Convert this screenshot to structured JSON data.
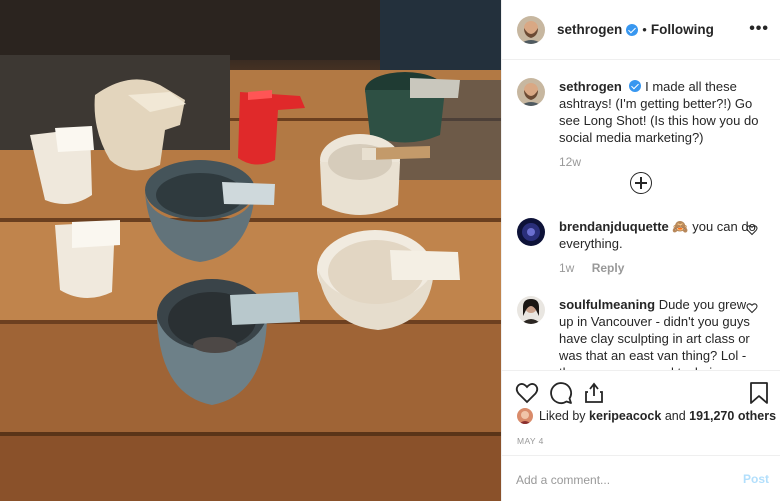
{
  "post": {
    "username": "sethrogen",
    "follow_status": "Following",
    "separator": "•",
    "more_icon": "more-options-icon",
    "more_glyph": "•••"
  },
  "caption": {
    "username": "sethrogen",
    "text": "I made all these ashtrays! (I'm getting better?!) Go see Long Shot! (Is this how you do social media marketing?)",
    "age": "12w"
  },
  "comments": [
    {
      "username": "brendanjduquette",
      "emoji": "🙈",
      "text": "you can do everything.",
      "age": "1w",
      "reply_label": "Reply"
    },
    {
      "username": "soulfulmeaning",
      "text": "Dude you grew up in Vancouver - didn't you guys have clay sculpting in art class or was that an east van thing? Lol - there are some cool techniques"
    }
  ],
  "likes": {
    "prefix": "Liked by",
    "first_user": "keripeacock",
    "conjunction": "and",
    "others": "191,270 others"
  },
  "date": "MAY 4",
  "add_comment": {
    "placeholder": "Add a comment...",
    "post_label": "Post"
  },
  "colors": {
    "verified": "#3897f0",
    "post_disabled": "#b2dffc",
    "muted": "#999999",
    "text": "#262626"
  },
  "icons": [
    "heart-icon",
    "comment-icon",
    "share-icon",
    "bookmark-icon",
    "load-more-icon",
    "verified-badge-icon"
  ]
}
